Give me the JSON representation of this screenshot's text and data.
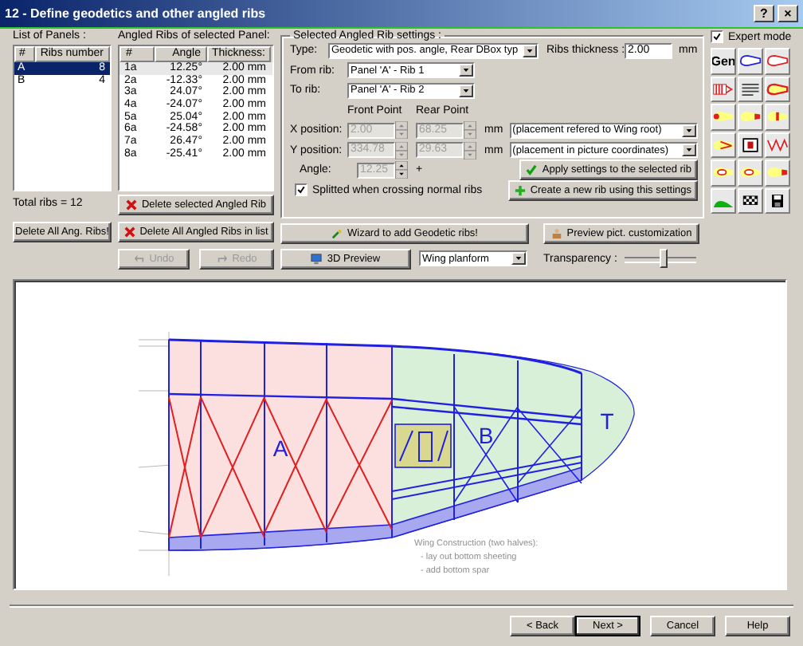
{
  "window": {
    "title": "12 - Define geodetics and other angled ribs",
    "help": "?",
    "close": "×"
  },
  "panels": {
    "label": "List of Panels :",
    "columns": [
      "#",
      "Ribs number"
    ],
    "rows": [
      {
        "name": "A",
        "ribs": "8",
        "selected": true
      },
      {
        "name": "B",
        "ribs": "4",
        "selected": false
      }
    ],
    "total": "Total ribs = 12",
    "delete_all": "Delete All Ang. Ribs!"
  },
  "angled_ribs": {
    "label": "Angled Ribs of selected Panel:",
    "columns": [
      "#",
      "Angle",
      "Thickness:"
    ],
    "rows": [
      {
        "id": "1a",
        "angle": "12.25°",
        "thickness": "2.00 mm",
        "selected": true
      },
      {
        "id": "2a",
        "angle": "-12.33°",
        "thickness": "2.00 mm",
        "selected": false
      },
      {
        "id": "3a",
        "angle": "24.07°",
        "thickness": "2.00 mm",
        "selected": false
      },
      {
        "id": "4a",
        "angle": "-24.07°",
        "thickness": "2.00 mm",
        "selected": false
      },
      {
        "id": "5a",
        "angle": "25.04°",
        "thickness": "2.00 mm",
        "selected": false
      },
      {
        "id": "6a",
        "angle": "-24.58°",
        "thickness": "2.00 mm",
        "selected": false
      },
      {
        "id": "7a",
        "angle": "26.47°",
        "thickness": "2.00 mm",
        "selected": false
      },
      {
        "id": "8a",
        "angle": "-25.41°",
        "thickness": "2.00 mm",
        "selected": false
      }
    ],
    "delete_selected": "Delete selected Angled Rib",
    "delete_all": "Delete All Angled Ribs in list",
    "undo": {
      "label": "Undo",
      "disabled": true
    },
    "redo": {
      "label": "Redo",
      "disabled": true
    }
  },
  "settings": {
    "title": "Selected Angled Rib settings :",
    "type_label": "Type:",
    "type": "Geodetic with pos. angle, Rear DBox typ",
    "thickness_label": "Ribs thickness :",
    "thickness": "2.00",
    "thickness_unit": "mm",
    "from_label": "From rib:",
    "from": "Panel 'A' - Rib 1",
    "to_label": "To rib:",
    "to": "Panel 'A' - Rib 2",
    "front_label": "Front Point",
    "rear_label": "Rear Point",
    "x_label": "X position:",
    "x_front": "2.00",
    "x_rear": "68.25",
    "x_unit": "mm",
    "x_ref": "(placement refered to Wing root)",
    "y_label": "Y position:",
    "y_front": "334.78",
    "y_rear": "29.63",
    "y_unit": "mm",
    "y_ref": "(placement in picture coordinates)",
    "positions_disabled": true,
    "angle_label": "Angle:",
    "angle": "12.25",
    "angle_extra": "+",
    "split_label": "Splitted when crossing normal ribs",
    "split": true,
    "apply": "Apply settings to the selected rib",
    "create": "Create a new rib using this settings"
  },
  "actions": {
    "wizard": "Wizard to add Geodetic ribs!",
    "preview_custom": "Preview pict. customization",
    "preview_3d": "3D Preview",
    "view": "Wing planform",
    "transparency_label": "Transparency :",
    "transparency": {
      "level": 0.53
    }
  },
  "expert_mode": {
    "label": "Expert mode",
    "checked": true
  },
  "tools": [
    {
      "glyph": "Gen",
      "kind": "gen"
    },
    {
      "kind": "outline-blue"
    },
    {
      "kind": "outline-red"
    },
    {
      "kind": "ribs"
    },
    {
      "kind": "text"
    },
    {
      "kind": "sheet"
    },
    {
      "kind": "le"
    },
    {
      "kind": "te"
    },
    {
      "kind": "spar"
    },
    {
      "kind": "slots"
    },
    {
      "kind": "deck"
    },
    {
      "kind": "geodetic"
    },
    {
      "kind": "hole"
    },
    {
      "kind": "hole"
    },
    {
      "kind": "te"
    },
    {
      "kind": "tip"
    },
    {
      "kind": "last"
    },
    {
      "kind": "save"
    }
  ],
  "drawing": {
    "panel_letters": [
      "A",
      "B",
      "T"
    ],
    "note": [
      "Wing Construction (two halves):",
      "- lay out bottom sheeting",
      "- add bottom spar"
    ]
  },
  "footer": [
    {
      "label": "< Back",
      "default": false
    },
    {
      "label": "Next >",
      "default": true
    },
    {
      "label": "Cancel",
      "default": false
    },
    {
      "label": "Help",
      "default": false
    }
  ]
}
